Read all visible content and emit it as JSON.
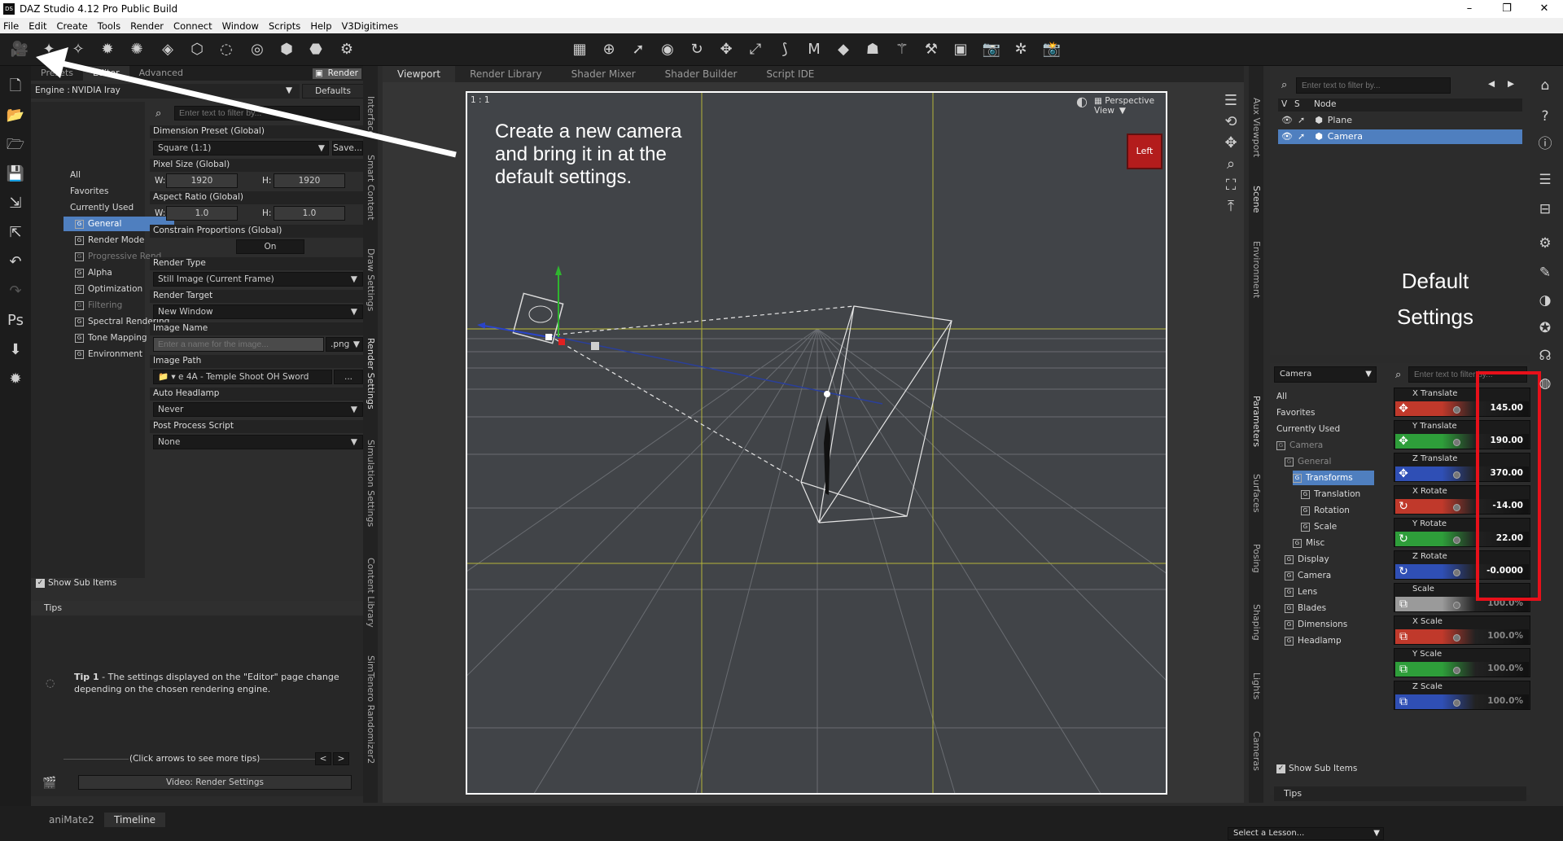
{
  "window": {
    "title": "DAZ Studio 4.12 Pro Public Build",
    "logo": "DS",
    "minimize": "–",
    "maximize": "❐",
    "close": "✕"
  },
  "menu": [
    "File",
    "Edit",
    "Create",
    "Tools",
    "Render",
    "Connect",
    "Window",
    "Scripts",
    "Help",
    "V3Digitimes"
  ],
  "render_settings": {
    "tabs": {
      "presets": "Presets",
      "editor": "Editor",
      "advanced": "Advanced",
      "render_button": "Render"
    },
    "engine_label": "Engine :",
    "engine_value": "NVIDIA Iray",
    "defaults_button": "Defaults",
    "filter_placeholder": "Enter text to filter by...",
    "tree": [
      {
        "label": "All",
        "state": "plain"
      },
      {
        "label": "Favorites",
        "state": "plain"
      },
      {
        "label": "Currently Used",
        "state": "plain"
      },
      {
        "label": "General",
        "state": "selected"
      },
      {
        "label": "Render Mode",
        "state": "normal"
      },
      {
        "label": "Progressive Rend...",
        "state": "dim"
      },
      {
        "label": "Alpha",
        "state": "normal"
      },
      {
        "label": "Optimization",
        "state": "normal"
      },
      {
        "label": "Filtering",
        "state": "dim"
      },
      {
        "label": "Spectral Rendering",
        "state": "normal"
      },
      {
        "label": "Tone Mapping",
        "state": "normal"
      },
      {
        "label": "Environment",
        "state": "normal"
      }
    ],
    "dimension_preset_label": "Dimension Preset (Global)",
    "dimension_preset_value": "Square (1:1)",
    "save_button": "Save...",
    "pixel_size_label": "Pixel Size (Global)",
    "w_label": "W:",
    "h_label": "H:",
    "pixel_w": "1920",
    "pixel_h": "1920",
    "aspect_ratio_label": "Aspect Ratio (Global)",
    "aspect_w": "1.0",
    "aspect_h": "1.0",
    "constrain_label": "Constrain Proportions (Global)",
    "constrain_value": "On",
    "render_type_label": "Render Type",
    "render_type_value": "Still Image (Current Frame)",
    "render_target_label": "Render Target",
    "render_target_value": "New Window",
    "image_name_label": "Image Name",
    "image_name_placeholder": "Enter a name for the image...",
    "image_ext": ".png",
    "image_path_label": "Image Path",
    "image_path_value": "e 4A - Temple Shoot OH Sword",
    "ellipsis": "...",
    "auto_headlamp_label": "Auto Headlamp",
    "auto_headlamp_value": "Never",
    "post_process_label": "Post Process Script",
    "post_process_value": "None",
    "show_sub_items": "Show Sub Items"
  },
  "tips": {
    "title": "Tips",
    "tip_bold": "Tip 1",
    "tip_text": " - The settings displayed on the \"Editor\" page change depending on the chosen rendering engine.",
    "nav_text": "(Click arrows to see more tips)",
    "prev": "<",
    "next": ">",
    "video_button": "Video: Render Settings"
  },
  "left_vertical_tabs": [
    "Interface",
    "Smart Content",
    "Draw Settings",
    "Render Settings",
    "Simulation Settings",
    "Content Library",
    "SimTenero Randomizer2"
  ],
  "viewport": {
    "tabs": [
      "Viewport",
      "Render Library",
      "Shader Mixer",
      "Shader Builder",
      "Script IDE"
    ],
    "ratio_label": "1 : 1",
    "view_name": "Perspective View",
    "cube_face": "Left"
  },
  "annotations": {
    "camera_note": [
      "Create a new camera",
      "and bring it in at the",
      "default settings."
    ],
    "settings_note": [
      "Default",
      "Settings"
    ]
  },
  "scene": {
    "filter_placeholder": "Enter text to filter by...",
    "header": [
      "V",
      "S",
      "Node"
    ],
    "nodes": [
      {
        "name": "Plane",
        "selected": false
      },
      {
        "name": "Camera",
        "selected": true
      }
    ]
  },
  "right_vertical_tabs_top": [
    "Aux Viewport",
    "Scene",
    "Environment"
  ],
  "right_vertical_tabs_bottom": [
    "Parameters",
    "Surfaces",
    "Posing",
    "Shaping",
    "Lights",
    "Cameras"
  ],
  "parameters": {
    "node_select": "Camera",
    "filter_placeholder": "Enter text to filter by...",
    "tree": [
      {
        "label": "All",
        "indent": 0,
        "icon": false,
        "state": "plain"
      },
      {
        "label": "Favorites",
        "indent": 0,
        "icon": false,
        "state": "plain"
      },
      {
        "label": "Currently Used",
        "indent": 0,
        "icon": false,
        "state": "plain"
      },
      {
        "label": "Camera",
        "indent": 0,
        "icon": true,
        "state": "dim"
      },
      {
        "label": "General",
        "indent": 1,
        "icon": true,
        "state": "dim"
      },
      {
        "label": "Transforms",
        "indent": 2,
        "icon": true,
        "state": "selected"
      },
      {
        "label": "Translation",
        "indent": 3,
        "icon": true,
        "state": "normal"
      },
      {
        "label": "Rotation",
        "indent": 3,
        "icon": true,
        "state": "normal"
      },
      {
        "label": "Scale",
        "indent": 3,
        "icon": true,
        "state": "normal"
      },
      {
        "label": "Misc",
        "indent": 2,
        "icon": true,
        "state": "normal"
      },
      {
        "label": "Display",
        "indent": 1,
        "icon": true,
        "state": "normal"
      },
      {
        "label": "Camera",
        "indent": 1,
        "icon": true,
        "state": "normal"
      },
      {
        "label": "Lens",
        "indent": 1,
        "icon": true,
        "state": "normal"
      },
      {
        "label": "Blades",
        "indent": 1,
        "icon": true,
        "state": "normal"
      },
      {
        "label": "Dimensions",
        "indent": 1,
        "icon": true,
        "state": "normal"
      },
      {
        "label": "Headlamp",
        "indent": 1,
        "icon": true,
        "state": "normal"
      }
    ],
    "sliders": [
      {
        "name": "X Translate",
        "value": "145.00",
        "color": "#c0392b",
        "icon": "✥"
      },
      {
        "name": "Y Translate",
        "value": "190.00",
        "color": "#2e9e3a",
        "icon": "✥"
      },
      {
        "name": "Z Translate",
        "value": "370.00",
        "color": "#2f4fb5",
        "icon": "✥"
      },
      {
        "name": "X Rotate",
        "value": "-14.00",
        "color": "#c0392b",
        "icon": "↻"
      },
      {
        "name": "Y Rotate",
        "value": "22.00",
        "color": "#2e9e3a",
        "icon": "↻"
      },
      {
        "name": "Z Rotate",
        "value": "-0.0000",
        "color": "#2f4fb5",
        "icon": "↻"
      },
      {
        "name": "Scale",
        "value": "100.0%",
        "color": "#9a9a9a",
        "icon": "⧉"
      },
      {
        "name": "X Scale",
        "value": "100.0%",
        "color": "#c0392b",
        "icon": "⧉"
      },
      {
        "name": "Y Scale",
        "value": "100.0%",
        "color": "#2e9e3a",
        "icon": "⧉"
      },
      {
        "name": "Z Scale",
        "value": "100.0%",
        "color": "#2f4fb5",
        "icon": "⧉"
      }
    ],
    "show_sub_items": "Show Sub Items",
    "tips_tab": "Tips"
  },
  "bottom": {
    "tabs": [
      "aniMate2",
      "Timeline"
    ],
    "lesson_select": "Select a Lesson..."
  },
  "colors": {
    "highlight_box": "#e8101a",
    "selection": "#4f7fbf",
    "accent_arrow": "#ffffff"
  }
}
